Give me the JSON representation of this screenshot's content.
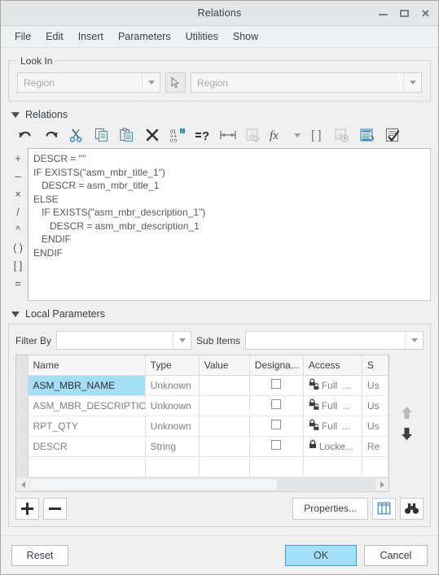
{
  "window": {
    "title": "Relations",
    "controls": {
      "minimize": "minimize-icon",
      "maximize": "maximize-icon",
      "close": "✕"
    }
  },
  "menubar": {
    "items": [
      "File",
      "Edit",
      "Insert",
      "Parameters",
      "Utilities",
      "Show"
    ]
  },
  "look_in": {
    "legend": "Look In",
    "type_combo": {
      "value": "Region",
      "is_placeholder": true
    },
    "select_button": "pointer-select-icon",
    "object_combo": {
      "value": "Region",
      "is_placeholder": true
    }
  },
  "relations": {
    "section_title": "Relations",
    "toolbar": [
      {
        "name": "undo-icon",
        "tooltip": "Undo"
      },
      {
        "name": "redo-icon",
        "tooltip": "Redo"
      },
      {
        "name": "cut-icon",
        "tooltip": "Cut"
      },
      {
        "name": "copy-icon",
        "tooltip": "Copy"
      },
      {
        "name": "paste-icon",
        "tooltip": "Paste"
      },
      {
        "name": "delete-icon",
        "tooltip": "Delete"
      },
      {
        "name": "units-icon",
        "tooltip": "Units"
      },
      {
        "name": "verify-icon",
        "tooltip": "Verify"
      },
      {
        "name": "dimension-icon",
        "tooltip": "Insert Dimension"
      },
      {
        "name": "search-relation-icon",
        "tooltip": "Search"
      },
      {
        "name": "function-icon",
        "tooltip": "Insert Function"
      },
      {
        "name": "function-dropdown-icon",
        "tooltip": "Function list"
      },
      {
        "name": "brackets-icon",
        "tooltip": "Brackets"
      },
      {
        "name": "history-icon",
        "tooltip": "History"
      },
      {
        "name": "execute-icon",
        "tooltip": "Execute"
      },
      {
        "name": "check-relations-icon",
        "tooltip": "Check Relations"
      }
    ],
    "operators": [
      "+",
      "–",
      "×",
      "/",
      "^",
      "( )",
      "[ ]",
      "="
    ],
    "code": "DESCR = \"\"\nIF EXISTS(\"asm_mbr_title_1\")\n   DESCR = asm_mbr_title_1\nELSE\n   IF EXISTS(\"asm_mbr_description_1\")\n      DESCR = asm_mbr_description_1\n   ENDIF\nENDIF"
  },
  "local_parameters": {
    "section_title": "Local Parameters",
    "filter_label": "Filter By",
    "filter_value": "",
    "sub_items_label": "Sub Items",
    "sub_items_value": "",
    "columns": [
      "Name",
      "Type",
      "Value",
      "Designa...",
      "Access",
      "S"
    ],
    "rows": [
      {
        "name": "ASM_MBR_NAME",
        "type": "Unknown",
        "value": "",
        "designated": false,
        "access": "Full",
        "access_icon": "lock-unlock-icon",
        "source": "Us",
        "selected": true
      },
      {
        "name": "ASM_MBR_DESCRIPTION",
        "type": "Unknown",
        "value": "",
        "designated": false,
        "access": "Full",
        "access_icon": "lock-unlock-icon",
        "source": "Us",
        "selected": false
      },
      {
        "name": "RPT_QTY",
        "type": "Unknown",
        "value": "",
        "designated": false,
        "access": "Full",
        "access_icon": "lock-unlock-icon",
        "source": "Us",
        "selected": false
      },
      {
        "name": "DESCR",
        "type": "String",
        "value": "",
        "designated": false,
        "access": "Locke...",
        "access_icon": "lock-icon",
        "source": "Re",
        "selected": false
      }
    ],
    "ellipsis": "...",
    "move_up": "move-up-arrow-icon",
    "move_down": "move-down-arrow-icon",
    "add_label": "+",
    "remove_label": "–",
    "properties_label": "Properties...",
    "columns_button": "columns-icon",
    "find_button": "binoculars-icon"
  },
  "footer": {
    "reset": "Reset",
    "ok": "OK",
    "cancel": "Cancel"
  },
  "colors": {
    "accent": "#a5dff7",
    "accent_border": "#3f9fd0",
    "window_bg": "#f0f0f0",
    "titlebar_bg": "#e4e6e8",
    "icon_blue": "#3c8dbc",
    "text": "#3a3f44",
    "muted_text": "#7c8084"
  }
}
